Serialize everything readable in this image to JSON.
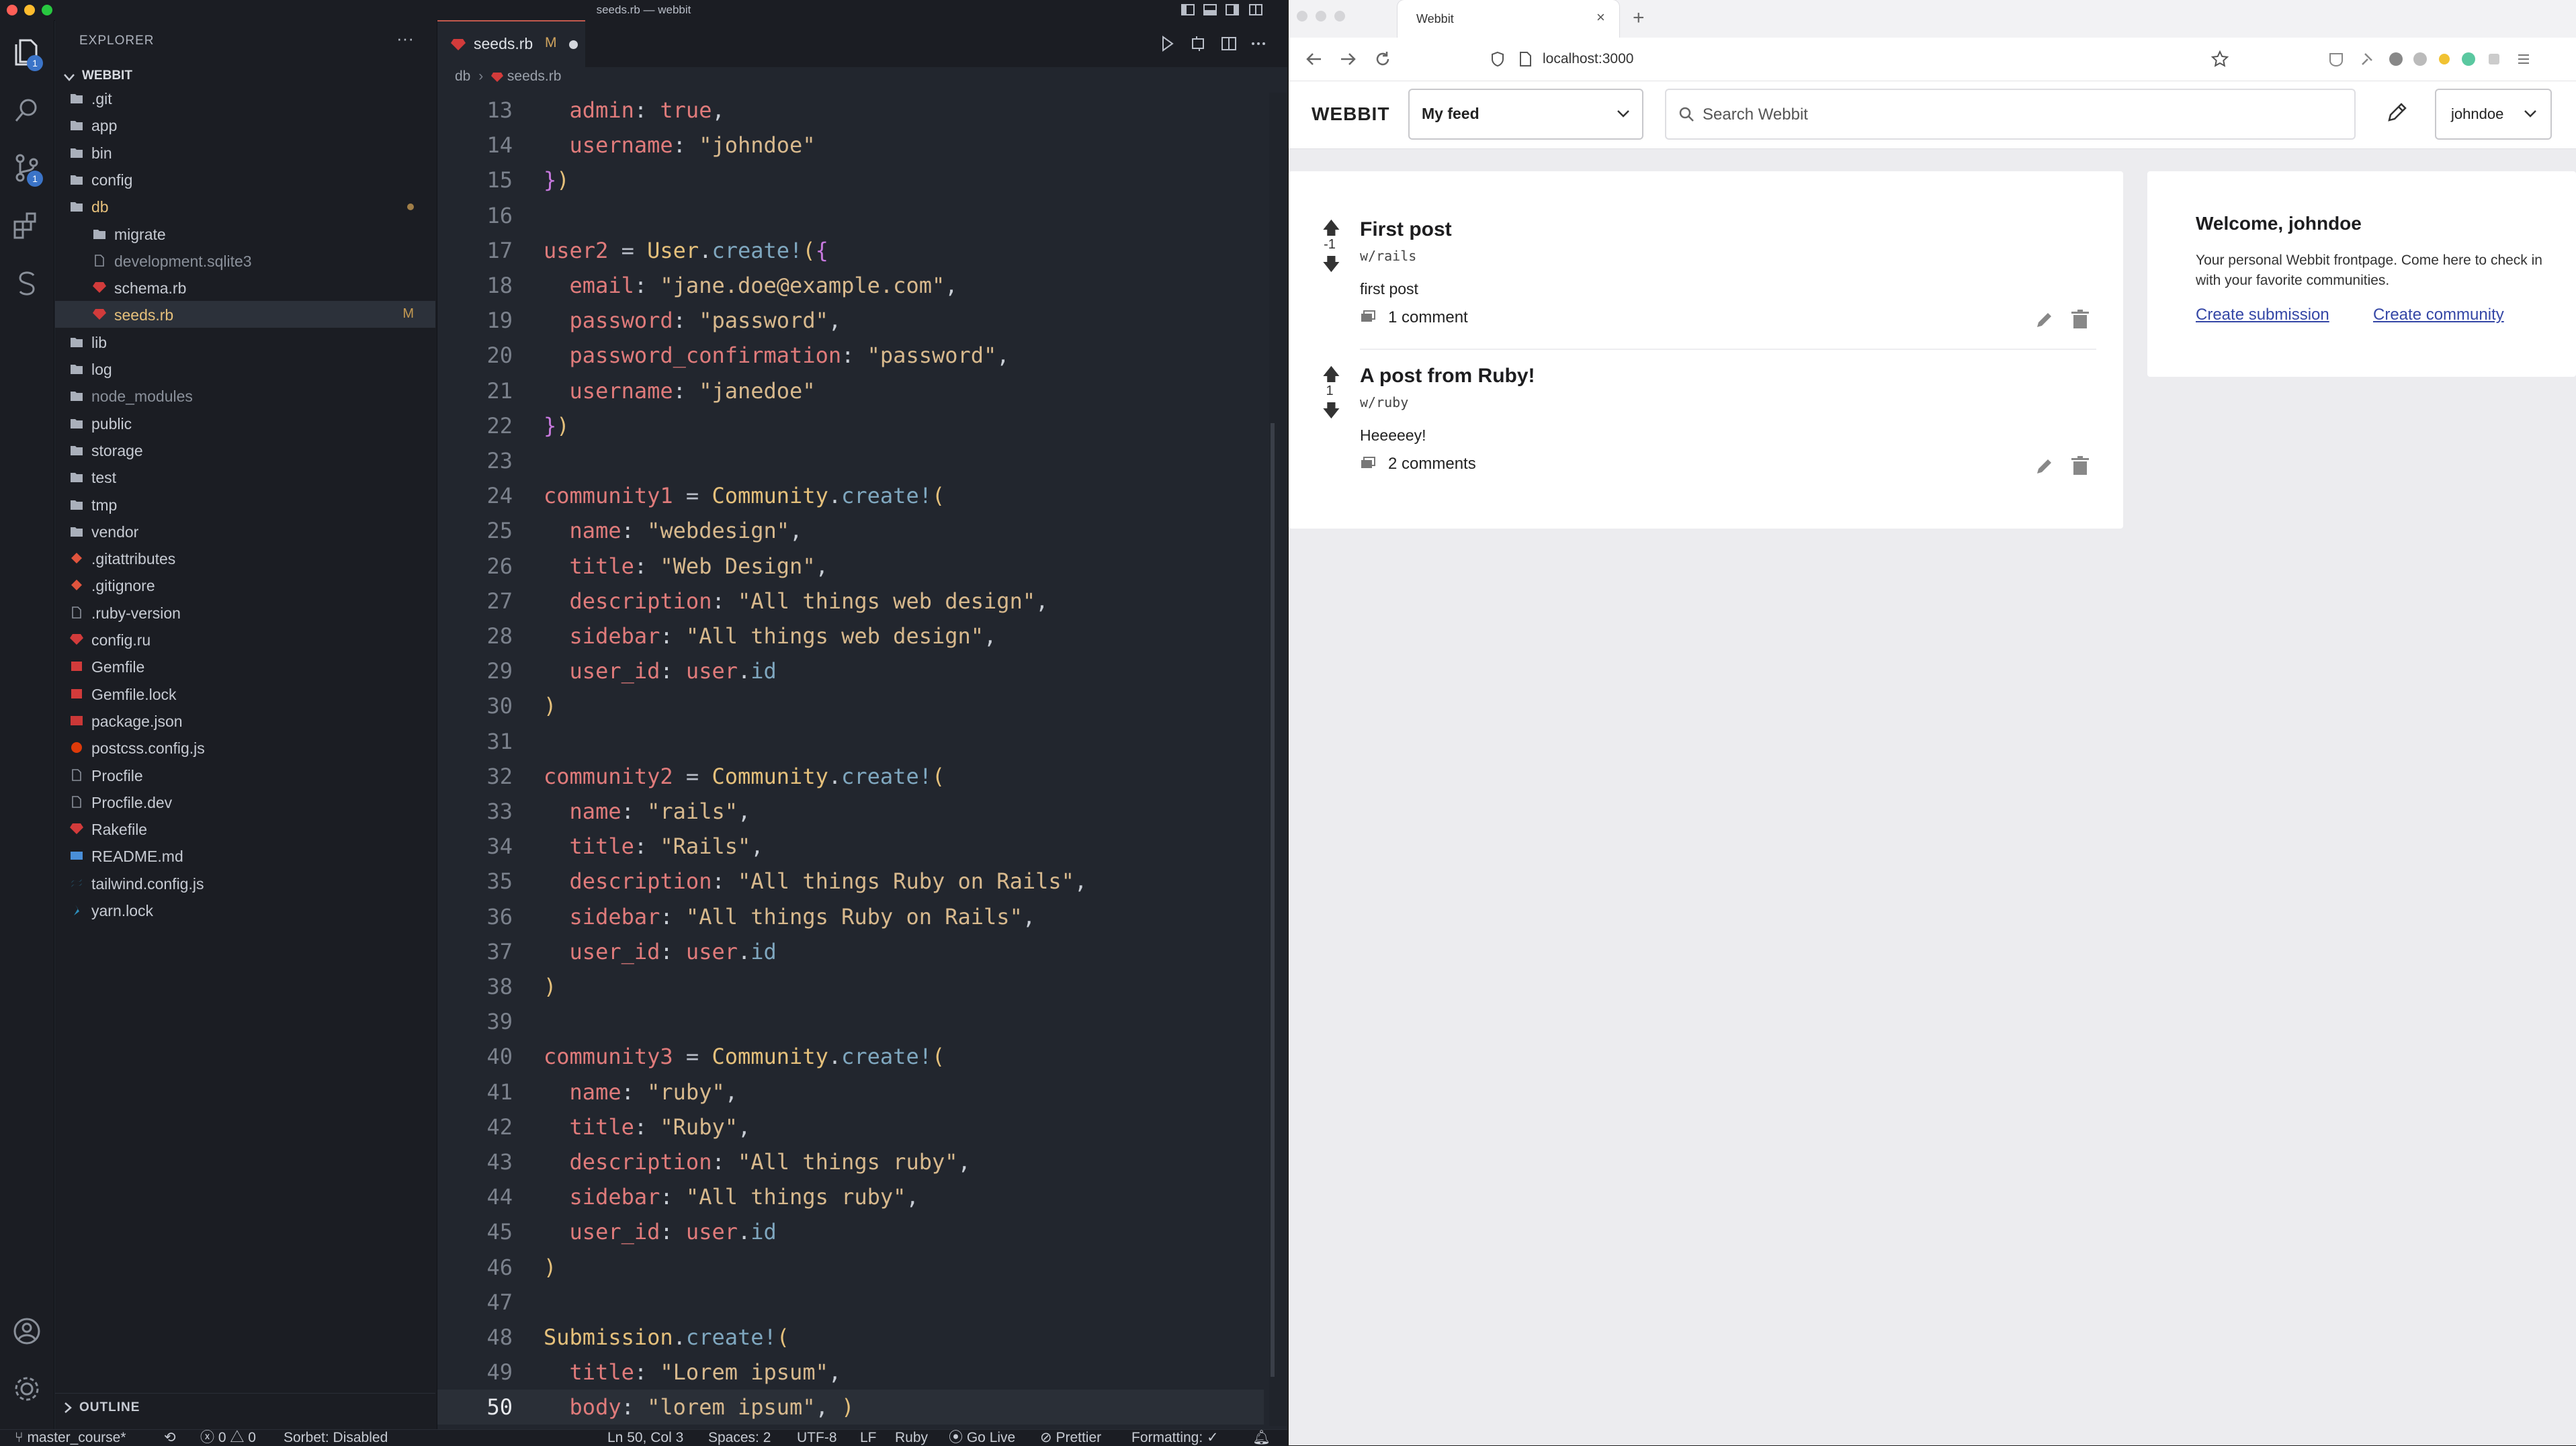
{
  "vscode": {
    "window_title": "seeds.rb — webbit",
    "explorer_title": "EXPLORER",
    "explorer_more": "···",
    "workspace": "WEBBIT",
    "source_control_badge": "1",
    "accounts_badge": "1",
    "tree": [
      {
        "label": ".git",
        "icon": "folder"
      },
      {
        "label": "app",
        "icon": "folder"
      },
      {
        "label": "bin",
        "icon": "folder"
      },
      {
        "label": "config",
        "icon": "folder"
      },
      {
        "label": "db",
        "icon": "folder-open"
      },
      {
        "label": "migrate",
        "icon": "folder"
      },
      {
        "label": "development.sqlite3",
        "icon": "file"
      },
      {
        "label": "schema.rb",
        "icon": "ruby"
      },
      {
        "label": "seeds.rb",
        "icon": "ruby",
        "git": "M"
      },
      {
        "label": "lib",
        "icon": "folder"
      },
      {
        "label": "log",
        "icon": "folder"
      },
      {
        "label": "node_modules",
        "icon": "folder"
      },
      {
        "label": "public",
        "icon": "folder"
      },
      {
        "label": "storage",
        "icon": "folder"
      },
      {
        "label": "test",
        "icon": "folder"
      },
      {
        "label": "tmp",
        "icon": "folder"
      },
      {
        "label": "vendor",
        "icon": "folder"
      },
      {
        "label": ".gitattributes",
        "icon": "git"
      },
      {
        "label": ".gitignore",
        "icon": "git"
      },
      {
        "label": ".ruby-version",
        "icon": "file"
      },
      {
        "label": "config.ru",
        "icon": "ruby"
      },
      {
        "label": "Gemfile",
        "icon": "gem"
      },
      {
        "label": "Gemfile.lock",
        "icon": "gem"
      },
      {
        "label": "package.json",
        "icon": "npm"
      },
      {
        "label": "postcss.config.js",
        "icon": "postcss"
      },
      {
        "label": "Procfile",
        "icon": "file"
      },
      {
        "label": "Procfile.dev",
        "icon": "file"
      },
      {
        "label": "Rakefile",
        "icon": "ruby"
      },
      {
        "label": "README.md",
        "icon": "markdown"
      },
      {
        "label": "tailwind.config.js",
        "icon": "tailwind"
      },
      {
        "label": "yarn.lock",
        "icon": "yarn"
      }
    ],
    "outline_label": "OUTLINE",
    "tab": {
      "label": "seeds.rb",
      "status": "M"
    },
    "breadcrumb": {
      "folder": "db",
      "file": "seeds.rb"
    },
    "code_lines": [
      {
        "n": "13",
        "text": "  admin: true,"
      },
      {
        "n": "14",
        "text": "  username: \"johndoe\""
      },
      {
        "n": "15",
        "text": "})"
      },
      {
        "n": "16",
        "text": ""
      },
      {
        "n": "17",
        "text": "user2 = User.create!({"
      },
      {
        "n": "18",
        "text": "  email: \"jane.doe@example.com\","
      },
      {
        "n": "19",
        "text": "  password: \"password\","
      },
      {
        "n": "20",
        "text": "  password_confirmation: \"password\","
      },
      {
        "n": "21",
        "text": "  username: \"janedoe\""
      },
      {
        "n": "22",
        "text": "})"
      },
      {
        "n": "23",
        "text": ""
      },
      {
        "n": "24",
        "text": "community1 = Community.create!("
      },
      {
        "n": "25",
        "text": "  name: \"webdesign\","
      },
      {
        "n": "26",
        "text": "  title: \"Web Design\","
      },
      {
        "n": "27",
        "text": "  description: \"All things web design\","
      },
      {
        "n": "28",
        "text": "  sidebar: \"All things web design\","
      },
      {
        "n": "29",
        "text": "  user_id: user.id"
      },
      {
        "n": "30",
        "text": ")"
      },
      {
        "n": "31",
        "text": ""
      },
      {
        "n": "32",
        "text": "community2 = Community.create!("
      },
      {
        "n": "33",
        "text": "  name: \"rails\","
      },
      {
        "n": "34",
        "text": "  title: \"Rails\","
      },
      {
        "n": "35",
        "text": "  description: \"All things Ruby on Rails\","
      },
      {
        "n": "36",
        "text": "  sidebar: \"All things Ruby on Rails\","
      },
      {
        "n": "37",
        "text": "  user_id: user.id"
      },
      {
        "n": "38",
        "text": ")"
      },
      {
        "n": "39",
        "text": ""
      },
      {
        "n": "40",
        "text": "community3 = Community.create!("
      },
      {
        "n": "41",
        "text": "  name: \"ruby\","
      },
      {
        "n": "42",
        "text": "  title: \"Ruby\","
      },
      {
        "n": "43",
        "text": "  description: \"All things ruby\","
      },
      {
        "n": "44",
        "text": "  sidebar: \"All things ruby\","
      },
      {
        "n": "45",
        "text": "  user_id: user.id"
      },
      {
        "n": "46",
        "text": ")"
      },
      {
        "n": "47",
        "text": ""
      },
      {
        "n": "48",
        "text": "Submission.create!("
      },
      {
        "n": "49",
        "text": "  title: \"Lorem ipsum\","
      },
      {
        "n": "50",
        "text": "  body: \"lorem ipsum\", )",
        "current": true
      }
    ],
    "status": {
      "branch": "master_course*",
      "errors": "0",
      "warnings": "0",
      "sorbet": "Sorbet: Disabled",
      "position": "Ln 50, Col 3",
      "spaces": "Spaces: 2",
      "encoding": "UTF-8",
      "eol": "LF",
      "language": "Ruby",
      "go_live": "Go Live",
      "prettier": "Prettier",
      "formatting": "Formatting: ✓"
    }
  },
  "browser": {
    "tab_title": "Webbit",
    "tab_close": "×",
    "new_tab": "+",
    "url": "localhost:3000",
    "app": {
      "logo": "WEBBIT",
      "feed_select": "My feed",
      "search_placeholder": "Search Webbit",
      "user_menu": "johndoe",
      "posts": [
        {
          "title": "First post",
          "community": "w/rails",
          "score": "-1",
          "body": "first post",
          "comments": "1 comment"
        },
        {
          "title": "A post from Ruby!",
          "community": "w/ruby",
          "score": "1",
          "body": "Heeeeey!",
          "comments": "2 comments"
        }
      ],
      "welcome": {
        "title": "Welcome, johndoe",
        "text": "Your personal Webbit frontpage. Come here to check in with your favorite communities.",
        "create_submission": "Create submission",
        "create_community": "Create community"
      }
    }
  }
}
